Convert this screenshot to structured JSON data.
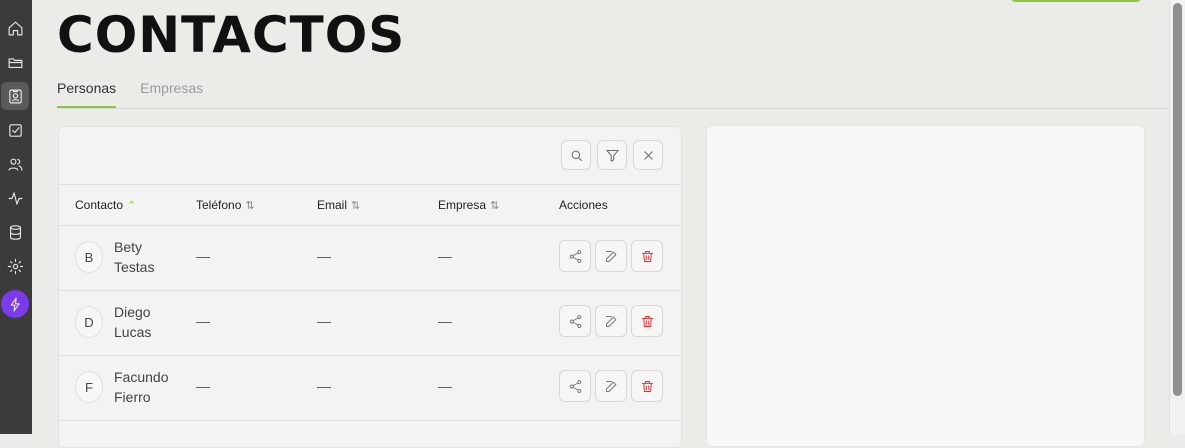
{
  "sidebar": {
    "icons": [
      "home-icon",
      "folder-icon",
      "contacts-icon",
      "tasks-icon",
      "users-icon",
      "activity-icon",
      "database-icon",
      "settings-icon",
      "bolt-icon"
    ],
    "active": "contacts-icon",
    "colors": {
      "bg": "#3b3b3b",
      "bolt_bg": "#7c3aed"
    }
  },
  "page": {
    "title": "CONTACTOS"
  },
  "tabs": [
    {
      "label": "Personas",
      "active": true
    },
    {
      "label": "Empresas",
      "active": false
    }
  ],
  "toolbar": {
    "icons": [
      "search-icon",
      "filter-icon",
      "close-icon"
    ]
  },
  "table": {
    "columns": [
      {
        "label": "Contacto",
        "sort": "asc"
      },
      {
        "label": "Teléfono",
        "sort": "none"
      },
      {
        "label": "Email",
        "sort": "none"
      },
      {
        "label": "Empresa",
        "sort": "none"
      },
      {
        "label": "Acciones",
        "sort": ""
      }
    ],
    "rows": [
      {
        "initial": "B",
        "first": "Bety",
        "last": "Testas",
        "phone": "—",
        "email": "—",
        "company": "—"
      },
      {
        "initial": "D",
        "first": "Diego",
        "last": "Lucas",
        "phone": "—",
        "email": "—",
        "company": "—"
      },
      {
        "initial": "F",
        "first": "Facundo",
        "last": "Fierro",
        "phone": "—",
        "email": "—",
        "company": "—"
      }
    ]
  },
  "colors": {
    "accent": "#8cc63f",
    "danger": "#e03131"
  }
}
